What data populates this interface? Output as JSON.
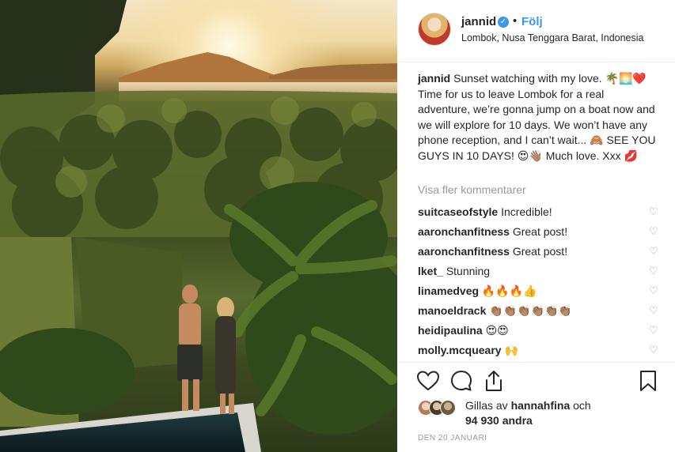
{
  "post": {
    "username": "jannid",
    "separator": "•",
    "follow_label": "Följ",
    "location": "Lombok, Nusa Tenggara Barat, Indonesia",
    "caption_user": "jannid",
    "caption_text": "Sunset watching with my love. 🌴🌅❤️ Time for us to leave Lombok for a real adventure, we’re gonna jump on a boat now and we will explore for 10 days. We won’t have any phone reception, and I can’t wait... 🙈 SEE YOU GUYS IN 10 DAYS! 😍👋🏽 Much love. Xxx 💋",
    "view_more_comments": "Visa fler kommentarer",
    "likes_prefix": "Gillas av",
    "likes_user": "hannahfina",
    "likes_suffix": "och",
    "likes_others": "94 930 andra",
    "date": "DEN 20 JANUARI"
  },
  "comments": [
    {
      "user": "suitcaseofstyle",
      "text": "Incredible!"
    },
    {
      "user": "aaronchanfitness",
      "text": "Great post!"
    },
    {
      "user": "aaronchanfitness",
      "text": "Great post!"
    },
    {
      "user": "lket_",
      "text": "Stunning"
    },
    {
      "user": "linamedveg",
      "text": "🔥🔥🔥👍"
    },
    {
      "user": "manoeldrack",
      "text": "👏🏽👏🏽👏🏽👏🏽👏🏽👏🏽"
    },
    {
      "user": "heidipaulina",
      "text": "😍😍"
    },
    {
      "user": "molly.mcqueary",
      "text": "🙌"
    }
  ],
  "icons": {
    "verified": "verified-badge-icon",
    "like": "heart-icon",
    "comment": "comment-icon",
    "share": "share-icon",
    "save": "bookmark-icon"
  },
  "colors": {
    "link": "#3897f0",
    "muted": "#999999",
    "text": "#262626"
  }
}
